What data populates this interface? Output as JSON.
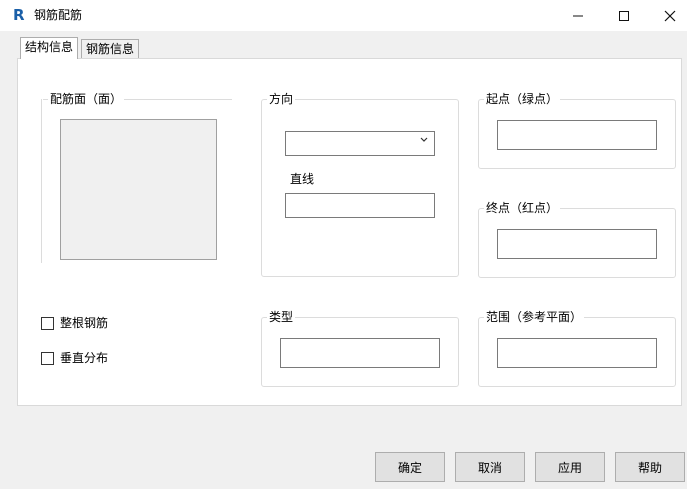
{
  "window": {
    "title": "钢筋配筋",
    "app_icon_letter": "R"
  },
  "tabs": [
    {
      "label": "结构信息"
    },
    {
      "label": "钢筋信息"
    }
  ],
  "groups": {
    "face": {
      "label": "配筋面（面）"
    },
    "direction": {
      "label": "方向",
      "select_value": "",
      "straight_label": "直线",
      "straight_value": ""
    },
    "start": {
      "label": "起点（绿点）",
      "value": ""
    },
    "end": {
      "label": "终点（红点）",
      "value": ""
    },
    "type": {
      "label": "类型",
      "value": ""
    },
    "range": {
      "label": "范围（参考平面）",
      "value": ""
    }
  },
  "checkboxes": [
    {
      "label": "整根钢筋"
    },
    {
      "label": "垂直分布"
    }
  ],
  "buttons": {
    "ok": "确定",
    "cancel": "取消",
    "apply": "应用",
    "help": "帮助"
  }
}
